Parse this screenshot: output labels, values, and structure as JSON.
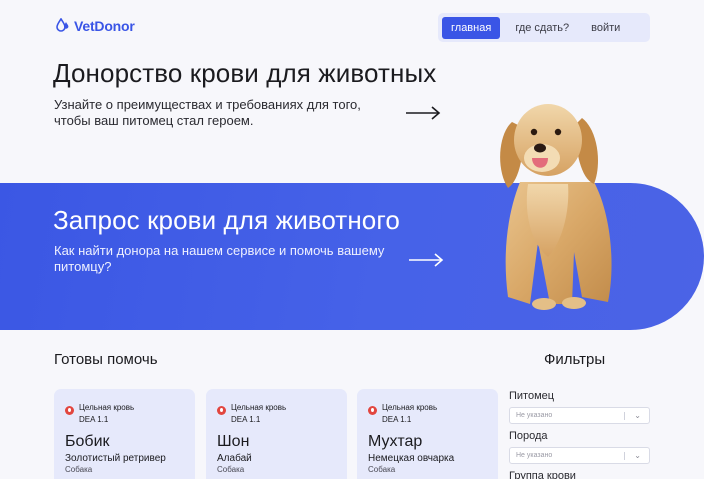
{
  "header": {
    "logo_text": "VetDonor",
    "nav": [
      "главная",
      "где сдать?",
      "войти"
    ]
  },
  "hero": {
    "title": "Донорство крови для животных",
    "subtitle": "Узнайте о преимуществах и требованиях для того, чтобы ваш питомец стал героем."
  },
  "banner": {
    "title": "Запрос крови для животного",
    "subtitle": "Как найти донора на нашем сервисе и помочь вашему питомцу?"
  },
  "ready": {
    "title": "Готовы помочь",
    "cards": [
      {
        "blood_type": "Цельная кровь",
        "dea": "DEA 1.1",
        "name": "Бобик",
        "breed": "Золотистый ретривер",
        "species": "Собака"
      },
      {
        "blood_type": "Цельная кровь",
        "dea": "DEA 1.1",
        "name": "Шон",
        "breed": "Алабай",
        "species": "Собака"
      },
      {
        "blood_type": "Цельная кровь",
        "dea": "DEA 1.1",
        "name": "Мухтар",
        "breed": "Немецкая овчарка",
        "species": "Собака"
      }
    ]
  },
  "filters": {
    "title": "Фильтры",
    "pet_label": "Питомец",
    "pet_value": "Не указано",
    "breed_label": "Порода",
    "breed_value": "Не указано",
    "blood_group_label": "Группа крови"
  },
  "colors": {
    "accent": "#3a55e6",
    "background": "#f7f7fb",
    "card": "#e6e9fb",
    "blood_dot": "#e2463f"
  }
}
